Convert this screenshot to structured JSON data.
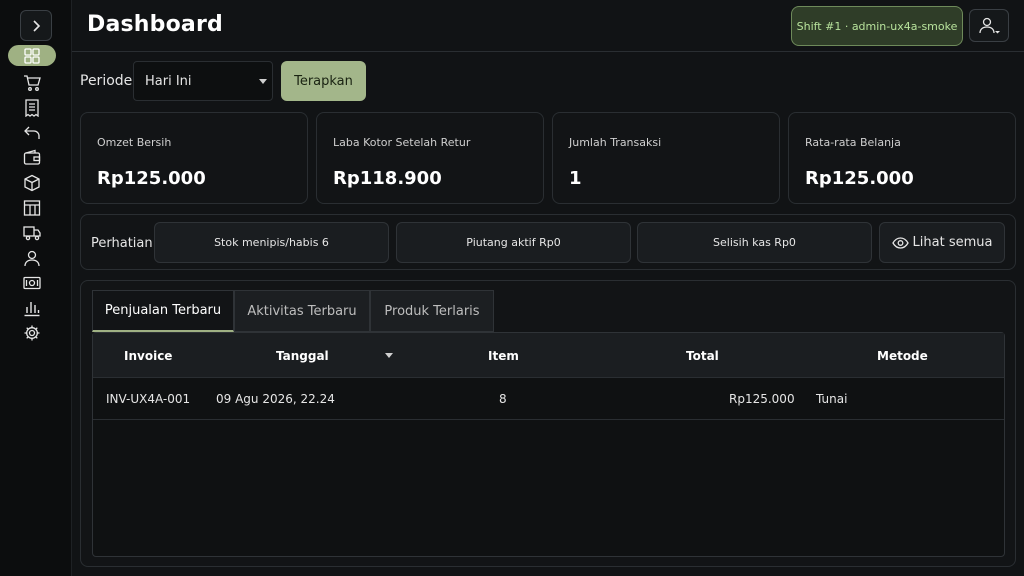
{
  "sidebar": {
    "items": [
      {
        "icon": "dashboard-icon",
        "active": true
      },
      {
        "icon": "cart-icon"
      },
      {
        "icon": "receipt-icon"
      },
      {
        "icon": "undo-icon"
      },
      {
        "icon": "wallet-icon"
      },
      {
        "icon": "box-icon"
      },
      {
        "icon": "table-icon"
      },
      {
        "icon": "truck-icon"
      },
      {
        "icon": "user-icon"
      },
      {
        "icon": "cash-icon"
      },
      {
        "icon": "bar-chart-icon"
      },
      {
        "icon": "gear-icon"
      }
    ]
  },
  "header": {
    "title": "Dashboard",
    "shift_badge": "Shift #1 · admin-ux4a-smoke"
  },
  "filter": {
    "label": "Periode",
    "selected": "Hari Ini",
    "apply_label": "Terapkan"
  },
  "stats": [
    {
      "label": "Omzet Bersih",
      "value": "Rp125.000"
    },
    {
      "label": "Laba Kotor Setelah Retur",
      "value": "Rp118.900"
    },
    {
      "label": "Jumlah Transaksi",
      "value": "1"
    },
    {
      "label": "Rata-rata Belanja",
      "value": "Rp125.000"
    }
  ],
  "attention": {
    "label": "Perhatian",
    "items": [
      {
        "text": "Stok menipis/habis  6"
      },
      {
        "text": "Piutang aktif  Rp0"
      },
      {
        "text": "Selisih kas  Rp0"
      }
    ],
    "see_all": "Lihat semua"
  },
  "tabs": [
    "Penjualan Terbaru",
    "Aktivitas Terbaru",
    "Produk Terlaris"
  ],
  "table": {
    "headers": [
      "Invoice",
      "Tanggal",
      "Item",
      "Total",
      "Metode"
    ],
    "rows": [
      {
        "invoice": "INV-UX4A-001",
        "tanggal": "09 Agu 2026, 22.24",
        "item": "8",
        "total": "Rp125.000",
        "metode": "Tunai"
      }
    ]
  },
  "colors": {
    "accent": "#9fb183",
    "shift_badge_text": "#b8e39c",
    "background": "#111315"
  }
}
